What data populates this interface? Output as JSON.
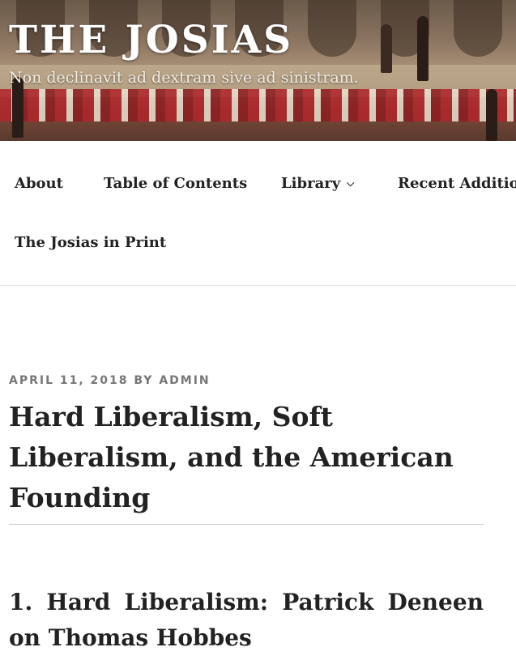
{
  "header": {
    "site_title": "THE JOSIAS",
    "site_description": "Non declinavit ad dextram sive ad sinistram."
  },
  "nav": {
    "items": [
      {
        "label": "About"
      },
      {
        "label": "Table of Contents"
      },
      {
        "label": "Library",
        "has_dropdown": true
      },
      {
        "label": "Recent Additions"
      },
      {
        "label": "The Josias in Print"
      }
    ]
  },
  "post": {
    "date": "APRIL 11, 2018",
    "by": "BY",
    "author": "ADMIN",
    "title": "Hard Liberalism, Soft Liberalism, and the American Founding",
    "section_heading": "1. Hard Liberalism: Patrick Deneen on Thomas Hobbes"
  },
  "colors": {
    "text": "#222222",
    "meta": "#767676",
    "divider": "#cccccc"
  }
}
